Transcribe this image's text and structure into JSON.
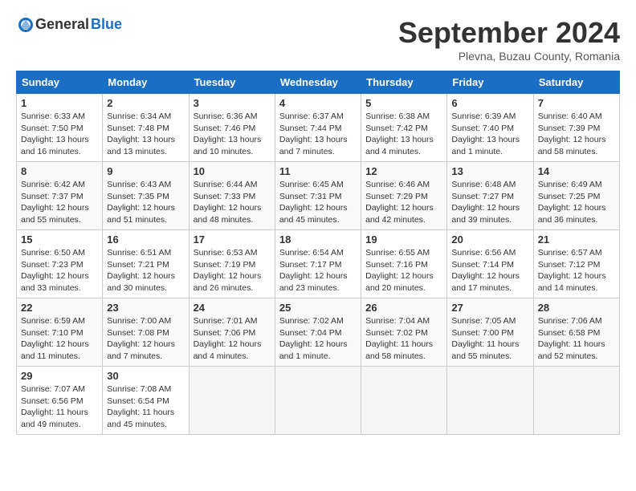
{
  "logo": {
    "general": "General",
    "blue": "Blue"
  },
  "title": "September 2024",
  "location": "Plevna, Buzau County, Romania",
  "days_header": [
    "Sunday",
    "Monday",
    "Tuesday",
    "Wednesday",
    "Thursday",
    "Friday",
    "Saturday"
  ],
  "weeks": [
    [
      {
        "day": "1",
        "info": "Sunrise: 6:33 AM\nSunset: 7:50 PM\nDaylight: 13 hours\nand 16 minutes."
      },
      {
        "day": "2",
        "info": "Sunrise: 6:34 AM\nSunset: 7:48 PM\nDaylight: 13 hours\nand 13 minutes."
      },
      {
        "day": "3",
        "info": "Sunrise: 6:36 AM\nSunset: 7:46 PM\nDaylight: 13 hours\nand 10 minutes."
      },
      {
        "day": "4",
        "info": "Sunrise: 6:37 AM\nSunset: 7:44 PM\nDaylight: 13 hours\nand 7 minutes."
      },
      {
        "day": "5",
        "info": "Sunrise: 6:38 AM\nSunset: 7:42 PM\nDaylight: 13 hours\nand 4 minutes."
      },
      {
        "day": "6",
        "info": "Sunrise: 6:39 AM\nSunset: 7:40 PM\nDaylight: 13 hours\nand 1 minute."
      },
      {
        "day": "7",
        "info": "Sunrise: 6:40 AM\nSunset: 7:39 PM\nDaylight: 12 hours\nand 58 minutes."
      }
    ],
    [
      {
        "day": "8",
        "info": "Sunrise: 6:42 AM\nSunset: 7:37 PM\nDaylight: 12 hours\nand 55 minutes."
      },
      {
        "day": "9",
        "info": "Sunrise: 6:43 AM\nSunset: 7:35 PM\nDaylight: 12 hours\nand 51 minutes."
      },
      {
        "day": "10",
        "info": "Sunrise: 6:44 AM\nSunset: 7:33 PM\nDaylight: 12 hours\nand 48 minutes."
      },
      {
        "day": "11",
        "info": "Sunrise: 6:45 AM\nSunset: 7:31 PM\nDaylight: 12 hours\nand 45 minutes."
      },
      {
        "day": "12",
        "info": "Sunrise: 6:46 AM\nSunset: 7:29 PM\nDaylight: 12 hours\nand 42 minutes."
      },
      {
        "day": "13",
        "info": "Sunrise: 6:48 AM\nSunset: 7:27 PM\nDaylight: 12 hours\nand 39 minutes."
      },
      {
        "day": "14",
        "info": "Sunrise: 6:49 AM\nSunset: 7:25 PM\nDaylight: 12 hours\nand 36 minutes."
      }
    ],
    [
      {
        "day": "15",
        "info": "Sunrise: 6:50 AM\nSunset: 7:23 PM\nDaylight: 12 hours\nand 33 minutes."
      },
      {
        "day": "16",
        "info": "Sunrise: 6:51 AM\nSunset: 7:21 PM\nDaylight: 12 hours\nand 30 minutes."
      },
      {
        "day": "17",
        "info": "Sunrise: 6:53 AM\nSunset: 7:19 PM\nDaylight: 12 hours\nand 26 minutes."
      },
      {
        "day": "18",
        "info": "Sunrise: 6:54 AM\nSunset: 7:17 PM\nDaylight: 12 hours\nand 23 minutes."
      },
      {
        "day": "19",
        "info": "Sunrise: 6:55 AM\nSunset: 7:16 PM\nDaylight: 12 hours\nand 20 minutes."
      },
      {
        "day": "20",
        "info": "Sunrise: 6:56 AM\nSunset: 7:14 PM\nDaylight: 12 hours\nand 17 minutes."
      },
      {
        "day": "21",
        "info": "Sunrise: 6:57 AM\nSunset: 7:12 PM\nDaylight: 12 hours\nand 14 minutes."
      }
    ],
    [
      {
        "day": "22",
        "info": "Sunrise: 6:59 AM\nSunset: 7:10 PM\nDaylight: 12 hours\nand 11 minutes."
      },
      {
        "day": "23",
        "info": "Sunrise: 7:00 AM\nSunset: 7:08 PM\nDaylight: 12 hours\nand 7 minutes."
      },
      {
        "day": "24",
        "info": "Sunrise: 7:01 AM\nSunset: 7:06 PM\nDaylight: 12 hours\nand 4 minutes."
      },
      {
        "day": "25",
        "info": "Sunrise: 7:02 AM\nSunset: 7:04 PM\nDaylight: 12 hours\nand 1 minute."
      },
      {
        "day": "26",
        "info": "Sunrise: 7:04 AM\nSunset: 7:02 PM\nDaylight: 11 hours\nand 58 minutes."
      },
      {
        "day": "27",
        "info": "Sunrise: 7:05 AM\nSunset: 7:00 PM\nDaylight: 11 hours\nand 55 minutes."
      },
      {
        "day": "28",
        "info": "Sunrise: 7:06 AM\nSunset: 6:58 PM\nDaylight: 11 hours\nand 52 minutes."
      }
    ],
    [
      {
        "day": "29",
        "info": "Sunrise: 7:07 AM\nSunset: 6:56 PM\nDaylight: 11 hours\nand 49 minutes."
      },
      {
        "day": "30",
        "info": "Sunrise: 7:08 AM\nSunset: 6:54 PM\nDaylight: 11 hours\nand 45 minutes."
      },
      {
        "day": "",
        "info": ""
      },
      {
        "day": "",
        "info": ""
      },
      {
        "day": "",
        "info": ""
      },
      {
        "day": "",
        "info": ""
      },
      {
        "day": "",
        "info": ""
      }
    ]
  ]
}
